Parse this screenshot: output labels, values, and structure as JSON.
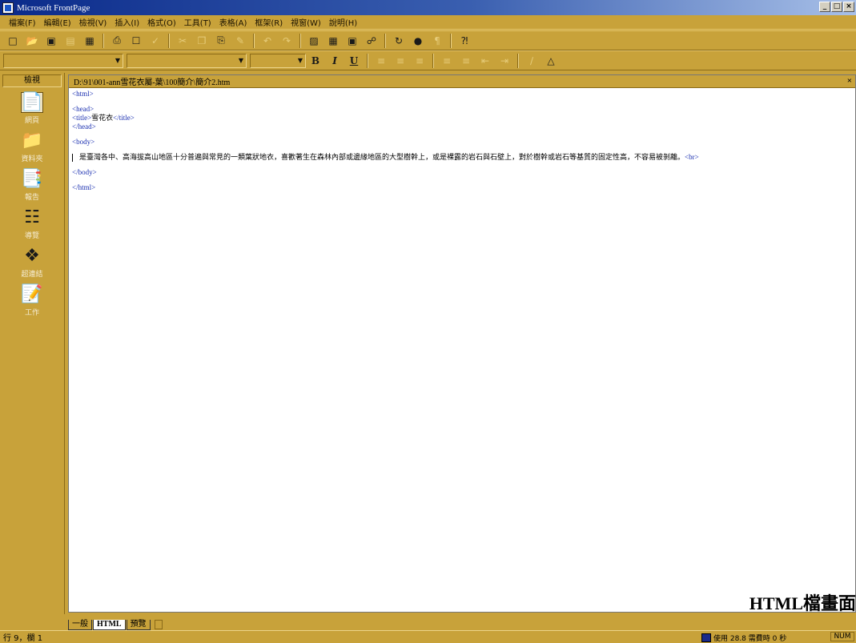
{
  "window": {
    "title": "Microsoft FrontPage",
    "controls": [
      "_",
      "□",
      "×"
    ]
  },
  "menu": [
    "檔案(F)",
    "編輯(E)",
    "檢視(V)",
    "插入(I)",
    "格式(O)",
    "工具(T)",
    "表格(A)",
    "框架(R)",
    "視窗(W)",
    "說明(H)"
  ],
  "toolbar": {
    "bold": "B",
    "italic": "I",
    "underline": "U"
  },
  "views": {
    "header": "檢視",
    "items": [
      {
        "label": "網頁",
        "icon": "page-view-icon"
      },
      {
        "label": "資料夾",
        "icon": "folder-view-icon"
      },
      {
        "label": "報告",
        "icon": "reports-view-icon"
      },
      {
        "label": "導覽",
        "icon": "navigation-view-icon"
      },
      {
        "label": "超連結",
        "icon": "hyperlinks-view-icon"
      },
      {
        "label": "工作",
        "icon": "tasks-view-icon"
      }
    ]
  },
  "editor": {
    "path": "D:\\91\\001-ann雪花衣屬-葉\\100簡介\\簡介2.htm",
    "close": "×",
    "code": {
      "html_open": "<html>",
      "head_open": "<head>",
      "title_open": "<title>",
      "title_text": "雪花衣",
      "title_close": "</title>",
      "head_close": "</head>",
      "body_open": "<body>",
      "paragraph": "是臺灣各中、高海拔高山地區十分普遍與常見的一類葉狀地衣，喜歡著生在森林內部或邊緣地區的大型樹幹上，或是裸露的岩石與石壁上，對於樹幹或岩石等基質的固定性高，不容易被剝離。",
      "br": "<br>",
      "body_close": "</body>",
      "html_close": "</html>"
    }
  },
  "watermark": "HTML檔畫面",
  "tabs": [
    {
      "label": "一般",
      "active": false
    },
    {
      "label": "HTML",
      "active": true
    },
    {
      "label": "預覽",
      "active": false
    }
  ],
  "status": {
    "position": "行 9，欄 1",
    "download": "使用 28.8 需費時 0 秒",
    "num": "NUM"
  }
}
